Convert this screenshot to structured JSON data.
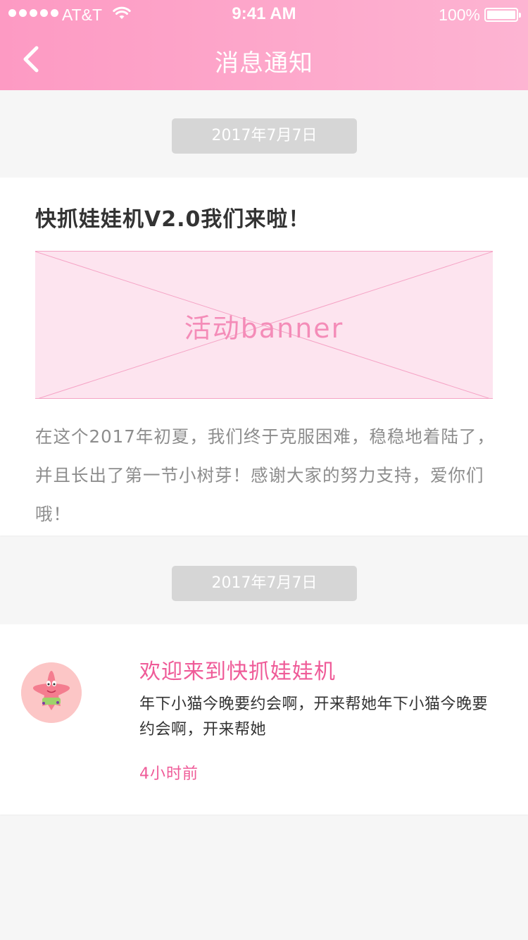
{
  "status_bar": {
    "carrier": "AT&T",
    "time": "9:41 AM",
    "battery": "100%"
  },
  "nav": {
    "title": "消息通知",
    "back_icon": "chevron-left-icon"
  },
  "messages": [
    {
      "date": "2017年7月7日",
      "title": "快抓娃娃机V2.0我们来啦！",
      "banner_label": "活动banner",
      "body": "在这个2017年初夏，我们终于克服困难，稳稳地着陆了，并且长出了第一节小树芽！感谢大家的努力支持，爱你们哦！"
    },
    {
      "date": "2017年7月7日",
      "title": "欢迎来到快抓娃娃机",
      "body": "年下小猫今晚要约会啊，开来帮她年下小猫今晚要约会啊，开来帮她",
      "time": "4小时前"
    }
  ],
  "colors": {
    "header_start": "#fd9ac3",
    "header_end": "#fdb4d2",
    "accent": "#ef5b98",
    "banner_bg": "#fde4ef",
    "date_pill": "#d6d6d6"
  }
}
